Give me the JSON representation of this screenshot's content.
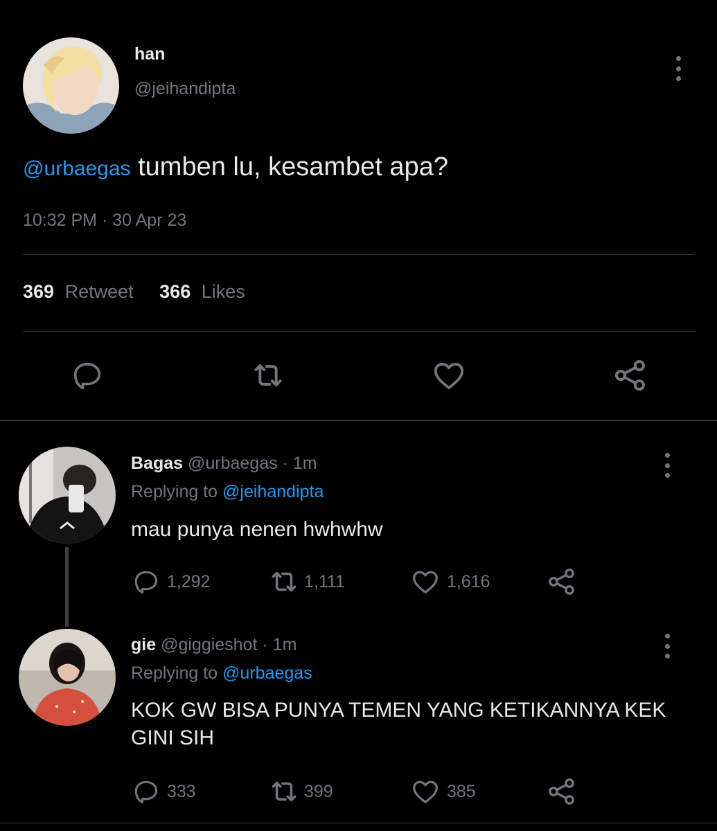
{
  "tweet": {
    "name": "han",
    "handle": "@jeihandipta",
    "mention": "@urbaegas",
    "text": " tumben lu, kesambet apa?",
    "time": "10:32 PM",
    "dot": "·",
    "date": "30 Apr 23",
    "retweets_count": "369",
    "retweets_label": "Retweet",
    "likes_count": "366",
    "likes_label": "Likes"
  },
  "replies": [
    {
      "name": "Bagas",
      "handle": "@urbaegas",
      "age": "· 1m",
      "replying_prefix": "Replying to",
      "replying_to": "@jeihandipta",
      "text": "mau punya nenen hwhwhw",
      "replies": "1,292",
      "retweets": "1,111",
      "likes": "1,616"
    },
    {
      "name": "gie",
      "handle": "@giggieshot",
      "age": "· 1m",
      "replying_prefix": "Replying to",
      "replying_to": "@urbaegas",
      "text": "KOK GW BISA PUNYA TEMEN YANG KETIKANNYA KEK GINI SIH",
      "replies": "333",
      "retweets": "399",
      "likes": "385"
    }
  ],
  "icons": [
    "more-vertical-icon",
    "reply-icon",
    "retweet-icon",
    "like-icon",
    "share-icon"
  ],
  "colors": {
    "background": "#000000",
    "text": "#e7e9ea",
    "muted": "#71767b",
    "link": "#1d9bf0",
    "divider": "#2f3336"
  }
}
